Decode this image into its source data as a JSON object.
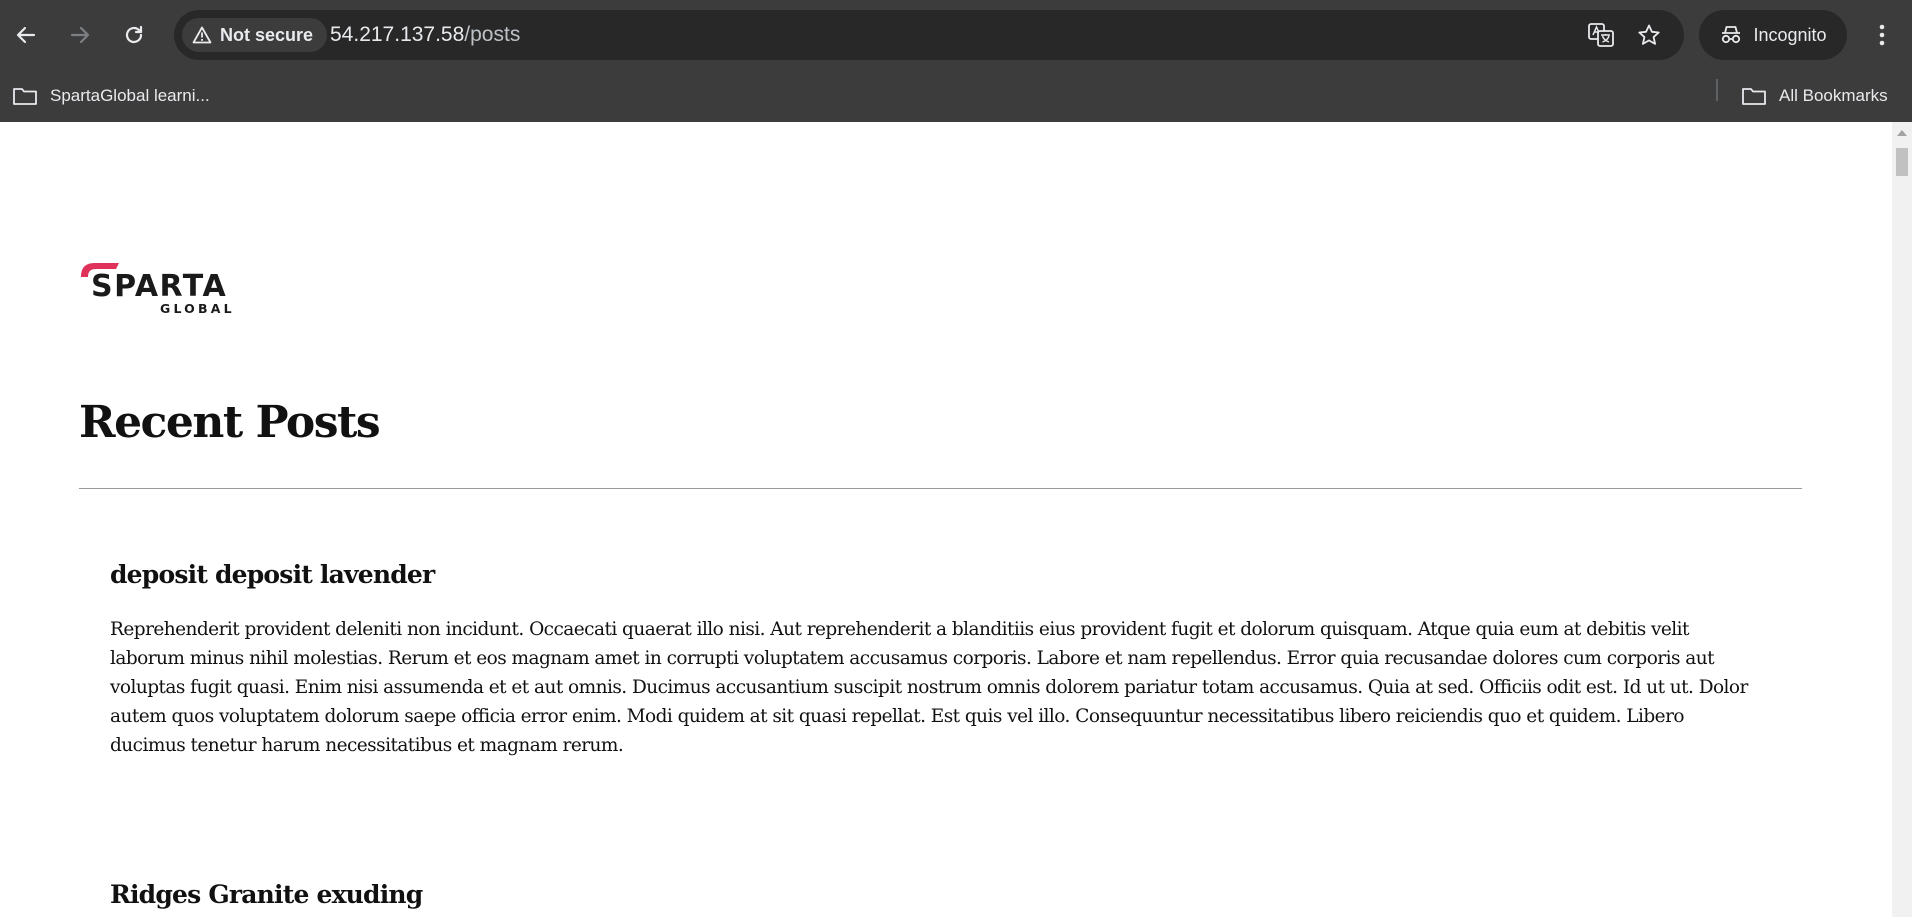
{
  "browser": {
    "security_label": "Not secure",
    "url_host": "54.217.137.58",
    "url_path": "/posts",
    "profile_label": "Incognito",
    "bookmarks": [
      {
        "label": "SpartaGlobal learni..."
      }
    ],
    "all_bookmarks_label": "All Bookmarks"
  },
  "page": {
    "logo_text": "SPARTA",
    "logo_subtext": "GLOBAL",
    "title": "Recent Posts",
    "posts": [
      {
        "title": "deposit deposit lavender",
        "body": "Reprehenderit provident deleniti non incidunt. Occaecati quaerat illo nisi. Aut reprehenderit a blanditiis eius provident fugit et dolorum quisquam. Atque quia eum at debitis velit laborum minus nihil molestias. Rerum et eos magnam amet in corrupti voluptatem accusamus corporis. Labore et nam repellendus. Error quia recusandae dolores cum corporis aut voluptas fugit quasi. Enim nisi assumenda et et aut omnis. Ducimus accusantium suscipit nostrum omnis dolorem pariatur totam accusamus. Quia at sed. Officiis odit est. Id ut ut. Dolor autem quos voluptatem dolorum saepe officia error enim. Modi quidem at sit quasi repellat. Est quis vel illo. Consequuntur necessitatibus libero reiciendis quo et quidem. Libero ducimus tenetur harum necessitatibus et magnam rerum."
      },
      {
        "title": "Ridges Granite exuding",
        "body": ""
      }
    ]
  },
  "colors": {
    "chrome": "#3c3c3c",
    "omnibox": "#282828",
    "brand_red": "#e0315a"
  },
  "icons": [
    "back-icon",
    "forward-icon",
    "reload-icon",
    "warning-icon",
    "translate-icon",
    "star-icon",
    "incognito-icon",
    "kebab-menu-icon",
    "folder-icon"
  ]
}
